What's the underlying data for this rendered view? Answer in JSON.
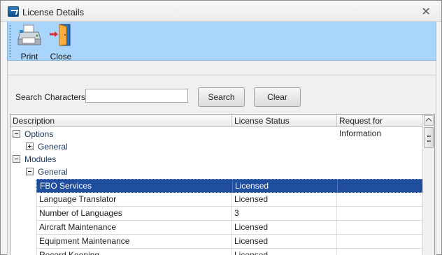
{
  "window": {
    "title": "License Details",
    "close_icon": "close-icon"
  },
  "toolbar": {
    "print_label": "Print",
    "print_icon": "printer-icon",
    "close_label": "Close",
    "close_icon": "door-exit-icon"
  },
  "search": {
    "label": "Search Characters :",
    "value": "",
    "placeholder": "",
    "search_button": "Search",
    "clear_button": "Clear"
  },
  "grid": {
    "columns": [
      "Description",
      "License Status",
      "Request for Information"
    ],
    "tree": [
      {
        "label": "Options",
        "state": "expanded"
      },
      {
        "label": "General",
        "state": "collapsed"
      },
      {
        "label": "Modules",
        "state": "expanded"
      },
      {
        "label": "General",
        "state": "expanded"
      }
    ],
    "rows": [
      {
        "description": "FBO Services",
        "status": "Licensed",
        "rfi": "",
        "selected": true
      },
      {
        "description": "Language Translator",
        "status": "Licensed",
        "rfi": ""
      },
      {
        "description": "Number of Languages",
        "status": "3",
        "rfi": ""
      },
      {
        "description": "Aircraft Maintenance",
        "status": "Licensed",
        "rfi": ""
      },
      {
        "description": "Equipment Maintenance",
        "status": "Licensed",
        "rfi": ""
      },
      {
        "description": "Record Keeping",
        "status": "Licensed",
        "rfi": ""
      }
    ]
  },
  "colors": {
    "toolbar_bg": "#a9d4fb",
    "selection": "#1f4e9e"
  }
}
